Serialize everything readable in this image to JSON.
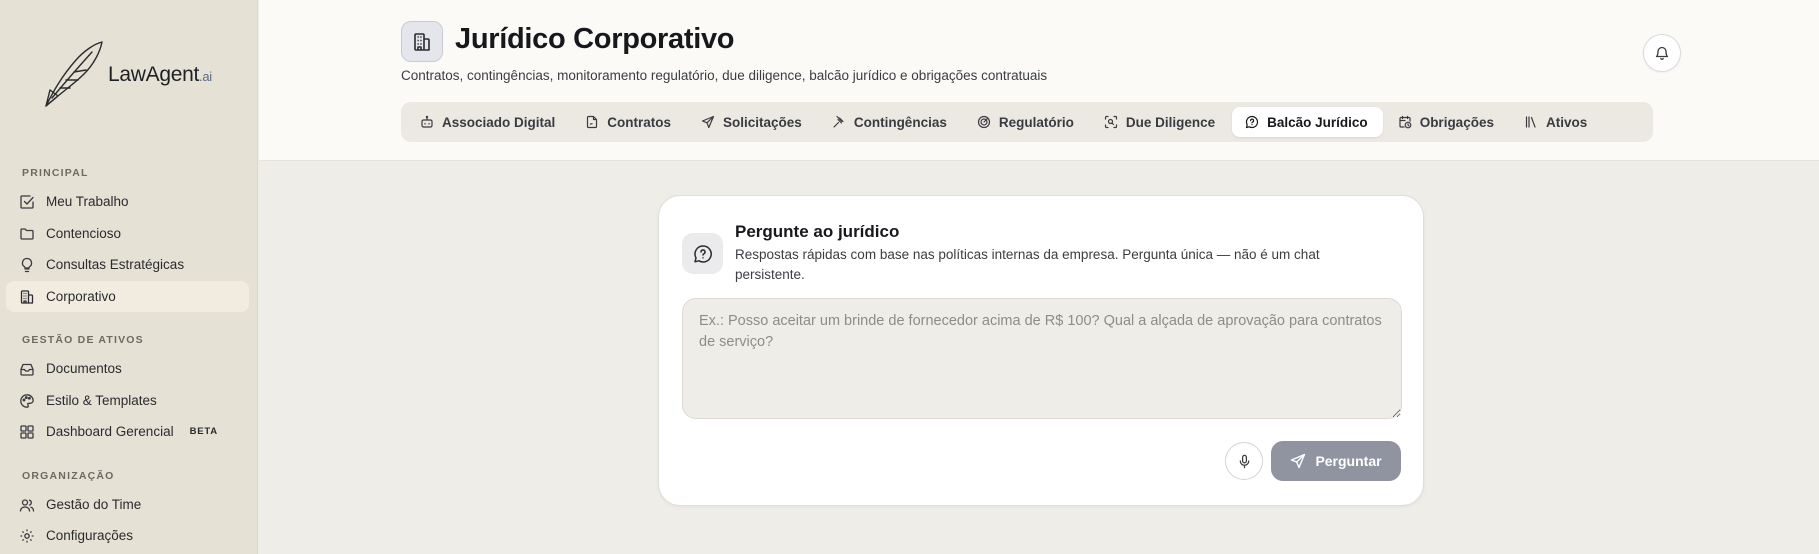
{
  "brand": {
    "name": "LawAgent",
    "suffix": ".ai"
  },
  "sidebar": {
    "sections": [
      {
        "title": "PRINCIPAL",
        "items": [
          {
            "label": "Meu Trabalho",
            "icon": "checkbox-icon"
          },
          {
            "label": "Contencioso",
            "icon": "folder-icon"
          },
          {
            "label": "Consultas Estratégicas",
            "icon": "lightbulb-icon"
          },
          {
            "label": "Corporativo",
            "icon": "building-icon",
            "active": true
          }
        ]
      },
      {
        "title": "GESTÃO DE ATIVOS",
        "items": [
          {
            "label": "Documentos",
            "icon": "inbox-icon"
          },
          {
            "label": "Estilo & Templates",
            "icon": "palette-icon"
          },
          {
            "label": "Dashboard Gerencial",
            "icon": "dashboard-icon",
            "badge": "BETA"
          }
        ]
      },
      {
        "title": "ORGANIZAÇÃO",
        "items": [
          {
            "label": "Gestão do Time",
            "icon": "users-icon"
          },
          {
            "label": "Configurações",
            "icon": "gear-icon"
          }
        ]
      }
    ]
  },
  "header": {
    "title": "Jurídico Corporativo",
    "subtitle": "Contratos, contingências, monitoramento regulatório, due diligence, balcão jurídico e obrigações contratuais",
    "tabs": [
      {
        "label": "Associado Digital",
        "icon": "bot-icon"
      },
      {
        "label": "Contratos",
        "icon": "file-signature-icon"
      },
      {
        "label": "Solicitações",
        "icon": "send-icon"
      },
      {
        "label": "Contingências",
        "icon": "gavel-icon"
      },
      {
        "label": "Regulatório",
        "icon": "radar-icon"
      },
      {
        "label": "Due Diligence",
        "icon": "scan-search-icon"
      },
      {
        "label": "Balcão Jurídico",
        "icon": "message-question-icon",
        "active": true
      },
      {
        "label": "Obrigações",
        "icon": "calendar-clock-icon"
      },
      {
        "label": "Ativos",
        "icon": "library-icon"
      }
    ]
  },
  "ask": {
    "title": "Pergunte ao jurídico",
    "description": "Respostas rápidas com base nas políticas internas da empresa. Pergunta única — não é um chat persistente.",
    "placeholder": "Ex.: Posso aceitar um brinde de fornecedor acima de R$ 100? Qual a alçada de aprovação para contratos de serviço?",
    "value": "",
    "submit_label": "Perguntar"
  },
  "colors": {
    "sidebar_bg": "#e6e1d5",
    "active_nav_bg": "#f2ece0",
    "submit_bg": "#9094a1",
    "brand_ai": "#5a6b8c"
  }
}
